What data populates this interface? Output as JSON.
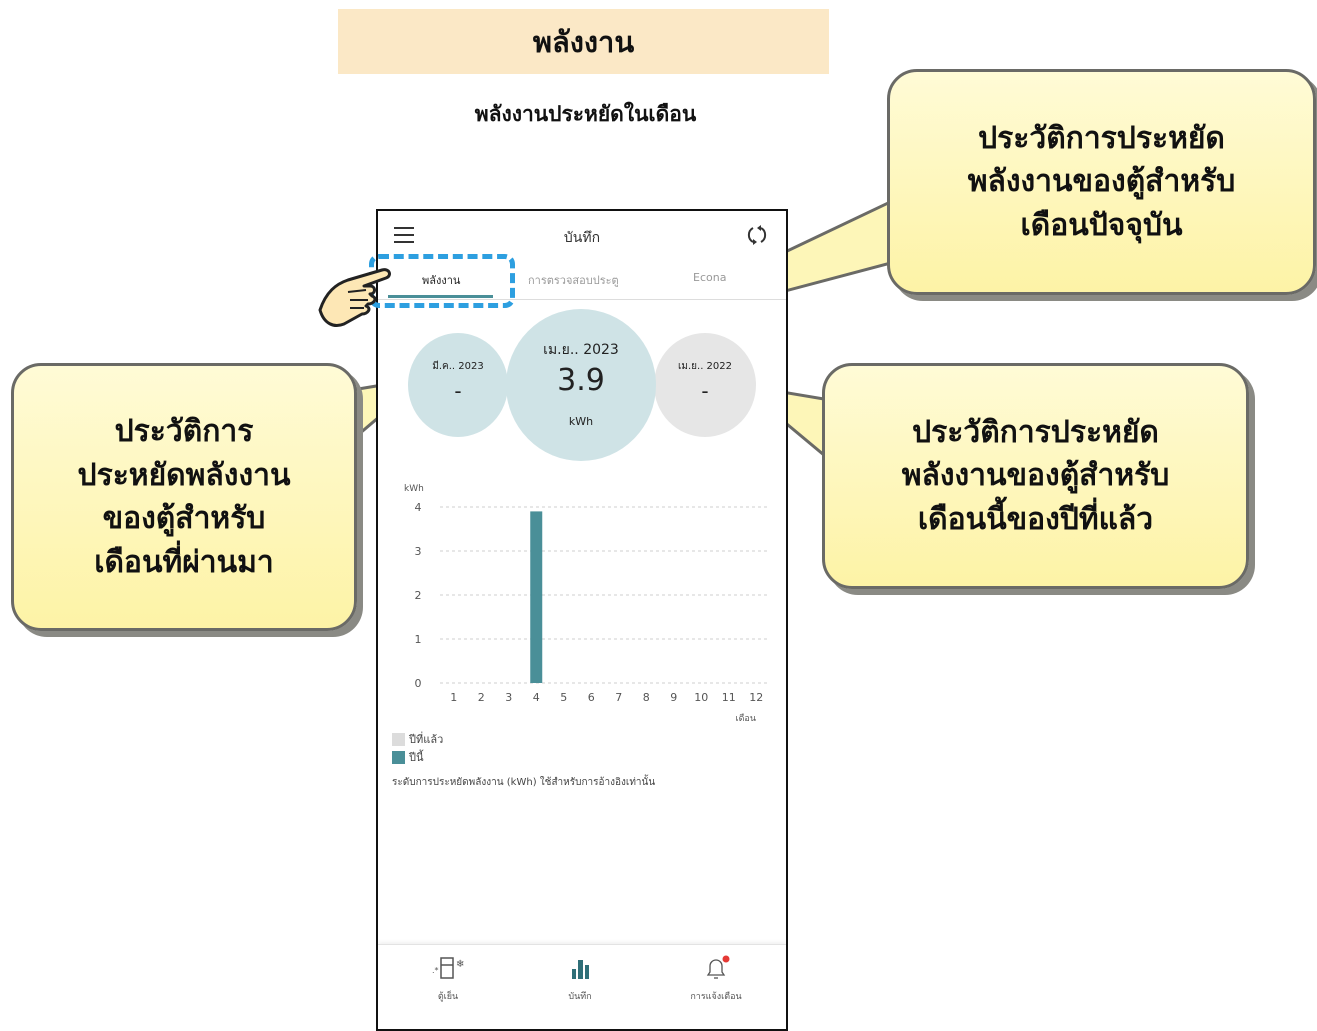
{
  "banner": {
    "title": "พลังงาน"
  },
  "subtitle": "พลังงานประหยัดในเดือน",
  "app": {
    "title": "บันทึก",
    "tabs": [
      "พลังงาน",
      "การตรวจสอบประตู",
      "Econa"
    ],
    "bubbles": {
      "previous": {
        "month": "มี.ค.. 2023",
        "value": "-"
      },
      "current": {
        "month": "เม.ย.. 2023",
        "value": "3.9",
        "unit": "kWh"
      },
      "last_year": {
        "month": "เม.ย.. 2022",
        "value": "-"
      }
    },
    "legend": {
      "last_year": "ปีที่แล้ว",
      "this_year": "ปีนี้"
    },
    "note": "ระดับการประหยัดพลังงาน (kWh) ใช้สำหรับการอ้างอิงเท่านั้น",
    "bottom_nav": [
      "ตู้เย็น",
      "บันทึก",
      "การแจ้งเตือน"
    ]
  },
  "chart_data": {
    "type": "bar",
    "ylabel": "kWh",
    "xlabel": "เดือน",
    "ylim": [
      0,
      4
    ],
    "yticks": [
      0,
      1,
      2,
      3,
      4
    ],
    "categories": [
      "1",
      "2",
      "3",
      "4",
      "5",
      "6",
      "7",
      "8",
      "9",
      "10",
      "11",
      "12"
    ],
    "series": [
      {
        "name": "ปีที่แล้ว",
        "color": "#dcdcdc",
        "values": [
          0,
          0,
          0,
          0,
          0,
          0,
          0,
          0,
          0,
          0,
          0,
          0
        ]
      },
      {
        "name": "ปีนี้",
        "color": "#4a8f98",
        "values": [
          0,
          0,
          0,
          3.9,
          0,
          0,
          0,
          0,
          0,
          0,
          0,
          0
        ]
      }
    ]
  },
  "callouts": {
    "current": [
      "ประวัติการประหยัด",
      "พลังงานของตู้สำหรับ",
      "เดือนปัจจุบัน"
    ],
    "previous": [
      "ประวัติการ",
      "ประหยัดพลังงาน",
      "ของตู้สำหรับ",
      "เดือนที่ผ่านมา"
    ],
    "last_year": [
      "ประวัติการประหยัด",
      "พลังงานของตู้สำหรับ",
      "เดือนนี้ของปีที่แล้ว"
    ]
  },
  "colors": {
    "accent": "#4a8f98",
    "banner": "#fbe8c6",
    "callout": "#fdf6b8",
    "highlight": "#2d9fe0",
    "notification_dot": "#e53935"
  }
}
